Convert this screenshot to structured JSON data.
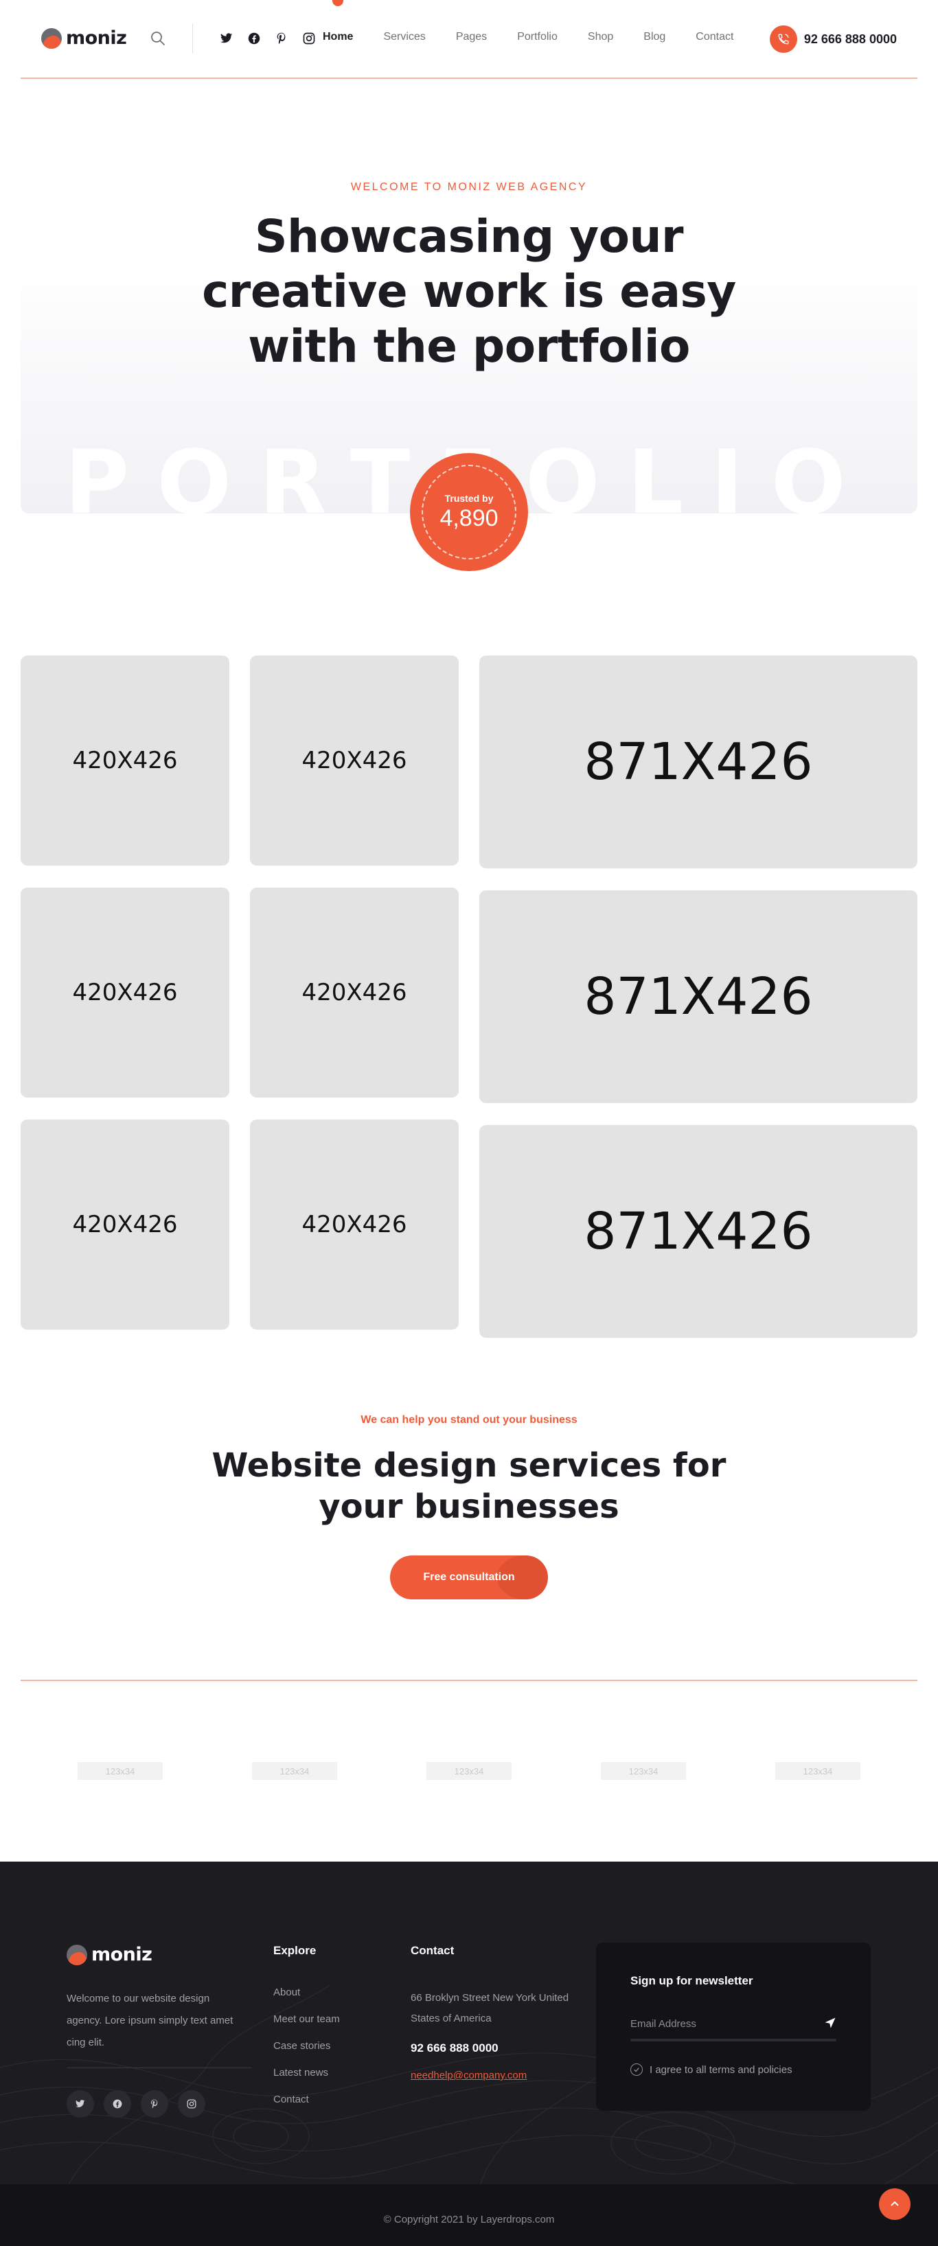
{
  "header": {
    "logo_text": "moniz",
    "search_icon": "search-icon",
    "socials": [
      "twitter-icon",
      "facebook-icon",
      "pinterest-icon",
      "instagram-icon"
    ],
    "nav": [
      "Home",
      "Services",
      "Pages",
      "Portfolio",
      "Shop",
      "Blog",
      "Contact"
    ],
    "active_nav": "Home",
    "phone": "92 666 888 0000",
    "phone_icon": "phone-icon"
  },
  "hero": {
    "eyebrow": "WELCOME TO MONIZ WEB AGENCY",
    "title": "Showcasing your creative work is easy with the portfolio",
    "watermark": "PORTFOLIO",
    "trusted_label": "Trusted by",
    "trusted_count": "4,890"
  },
  "portfolio": {
    "small_label": "420X426",
    "big_label": "871X426"
  },
  "cta": {
    "eyebrow": "We can help you stand out your business",
    "title": "Website design services for your businesses",
    "button": "Free consultation"
  },
  "brands": [
    "123x34",
    "123x34",
    "123x34",
    "123x34",
    "123x34"
  ],
  "footer": {
    "logo_text": "moniz",
    "about": "Welcome to our website design agency. Lore ipsum simply text amet cing elit.",
    "socials": [
      "twitter-icon",
      "facebook-icon",
      "pinterest-icon",
      "instagram-icon"
    ],
    "explore_title": "Explore",
    "explore_links": [
      "About",
      "Meet our team",
      "Case stories",
      "Latest news",
      "Contact"
    ],
    "contact_title": "Contact",
    "address": "66 Broklyn Street New York United States of America",
    "phone": "92 666 888 0000",
    "email": "needhelp@company.com",
    "newsletter_title": "Sign up for newsletter",
    "email_placeholder": "Email Address",
    "agree_label": "I agree to all terms and policies",
    "copyright": "© Copyright 2021 by Layerdrops.com"
  },
  "colors": {
    "accent": "#ef5b38",
    "dark": "#1c1c22",
    "footer_bg": "#1c1c21"
  }
}
